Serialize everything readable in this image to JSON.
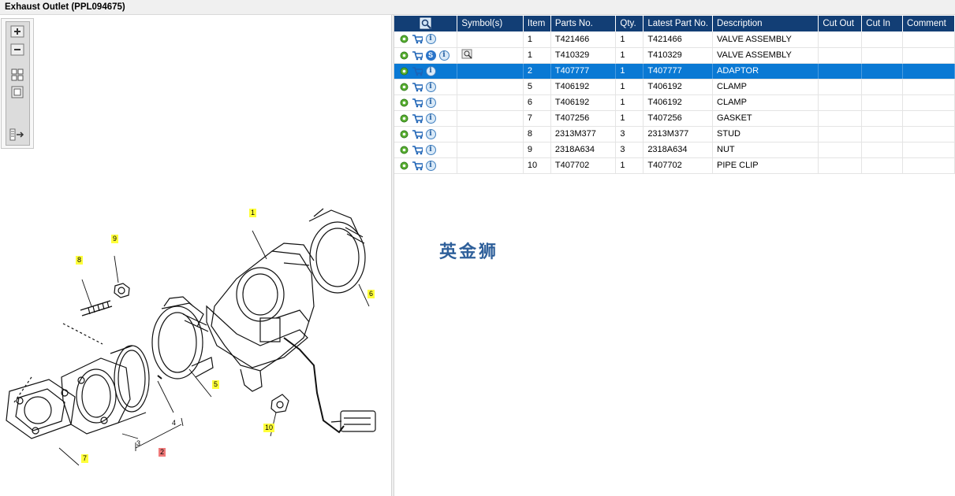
{
  "window": {
    "title": "Exhaust Outlet (PPL094675)"
  },
  "toolbar": {
    "buttons": [
      "zoom-in",
      "zoom-out",
      "fit-all",
      "fit-window",
      "toggle-panel"
    ]
  },
  "diagram": {
    "callouts": [
      {
        "label": "1",
        "color": "yellow"
      },
      {
        "label": "2",
        "color": "red"
      },
      {
        "label": "3",
        "color": "none"
      },
      {
        "label": "4",
        "color": "none"
      },
      {
        "label": "5",
        "color": "yellow"
      },
      {
        "label": "6",
        "color": "yellow"
      },
      {
        "label": "7",
        "color": "yellow"
      },
      {
        "label": "8",
        "color": "yellow"
      },
      {
        "label": "9",
        "color": "yellow"
      },
      {
        "label": "10",
        "color": "yellow"
      }
    ]
  },
  "table": {
    "headers": [
      "",
      "Symbol(s)",
      "Item",
      "Parts No.",
      "Qty.",
      "Latest Part No.",
      "Description",
      "Cut Out",
      "Cut In",
      "Comment"
    ],
    "rows": [
      {
        "item": "1",
        "part": "T421466",
        "qty": "1",
        "latest": "T421466",
        "desc": "VALVE ASSEMBLY",
        "cut_out": "",
        "cut_in": "",
        "comment": "",
        "has_s": false,
        "has_symbol": false,
        "selected": false
      },
      {
        "item": "1",
        "part": "T410329",
        "qty": "1",
        "latest": "T410329",
        "desc": "VALVE ASSEMBLY",
        "cut_out": "",
        "cut_in": "",
        "comment": "",
        "has_s": true,
        "has_symbol": true,
        "selected": false
      },
      {
        "item": "2",
        "part": "T407777",
        "qty": "1",
        "latest": "T407777",
        "desc": "ADAPTOR",
        "cut_out": "",
        "cut_in": "",
        "comment": "",
        "has_s": false,
        "has_symbol": false,
        "selected": true
      },
      {
        "item": "5",
        "part": "T406192",
        "qty": "1",
        "latest": "T406192",
        "desc": "CLAMP",
        "cut_out": "",
        "cut_in": "",
        "comment": "",
        "has_s": false,
        "has_symbol": false,
        "selected": false
      },
      {
        "item": "6",
        "part": "T406192",
        "qty": "1",
        "latest": "T406192",
        "desc": "CLAMP",
        "cut_out": "",
        "cut_in": "",
        "comment": "",
        "has_s": false,
        "has_symbol": false,
        "selected": false
      },
      {
        "item": "7",
        "part": "T407256",
        "qty": "1",
        "latest": "T407256",
        "desc": "GASKET",
        "cut_out": "",
        "cut_in": "",
        "comment": "",
        "has_s": false,
        "has_symbol": false,
        "selected": false
      },
      {
        "item": "8",
        "part": "2313M377",
        "qty": "3",
        "latest": "2313M377",
        "desc": "STUD",
        "cut_out": "",
        "cut_in": "",
        "comment": "",
        "has_s": false,
        "has_symbol": false,
        "selected": false
      },
      {
        "item": "9",
        "part": "2318A634",
        "qty": "3",
        "latest": "2318A634",
        "desc": "NUT",
        "cut_out": "",
        "cut_in": "",
        "comment": "",
        "has_s": false,
        "has_symbol": false,
        "selected": false
      },
      {
        "item": "10",
        "part": "T407702",
        "qty": "1",
        "latest": "T407702",
        "desc": "PIPE CLIP",
        "cut_out": "",
        "cut_in": "",
        "comment": "",
        "has_s": false,
        "has_symbol": false,
        "selected": false
      }
    ]
  },
  "watermark": "英金狮",
  "colors": {
    "header_bg": "#123e75",
    "selected_row": "#0a79d4",
    "callout_yellow": "#ffff3a",
    "callout_red": "#f07a7a"
  }
}
